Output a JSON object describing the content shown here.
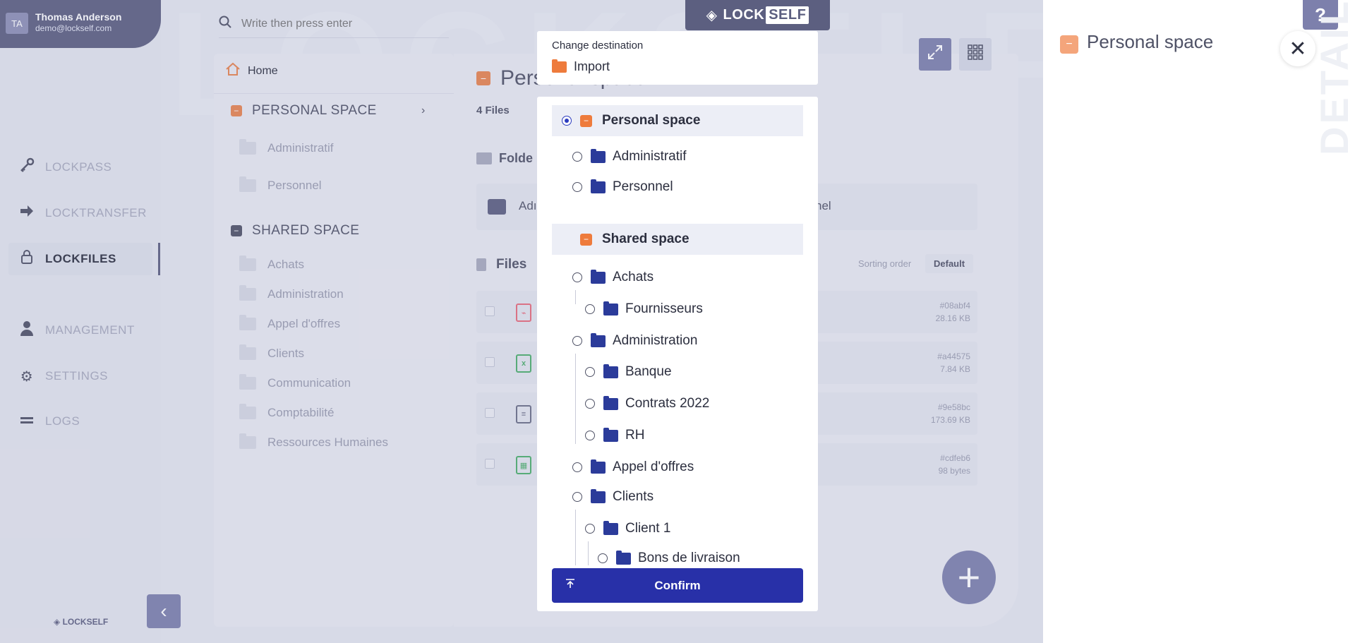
{
  "user": {
    "initials": "TA",
    "name": "Thomas Anderson",
    "email": "demo@lockself.com"
  },
  "nav": {
    "items": [
      {
        "label": "LOCKPASS",
        "icon": "key-icon"
      },
      {
        "label": "LOCKTRANSFER",
        "icon": "arrow-right-icon"
      },
      {
        "label": "LOCKFILES",
        "icon": "lock-icon",
        "active": true
      },
      {
        "label": "MANAGEMENT",
        "icon": "user-icon"
      },
      {
        "label": "SETTINGS",
        "icon": "gears-icon"
      },
      {
        "label": "LOGS",
        "icon": "list-icon"
      }
    ],
    "footer_logo": "LOCKSELF"
  },
  "search": {
    "placeholder": "Write then press enter"
  },
  "tree": {
    "home_label": "Home",
    "personal_section": "PERSONAL SPACE",
    "personal_folders": [
      "Administratif",
      "Personnel"
    ],
    "shared_section": "SHARED SPACE",
    "shared_folders": [
      "Achats",
      "Administration",
      "Appel d'offres",
      "Clients",
      "Communication",
      "Comptabilité",
      "Ressources Humaines"
    ]
  },
  "main": {
    "title": "Personal space",
    "file_count": "4 Files",
    "folders_label": "Folde",
    "folder_card_left": "Adı",
    "folder_card_right": "nel",
    "files_label": "Files",
    "sorting_label": "Sorting order",
    "sorting_value": "Default",
    "files": [
      {
        "type": "pdf",
        "hash": "#08abf4",
        "size": "28.16 KB"
      },
      {
        "type": "xls",
        "hash": "#a44575",
        "size": "7.84 KB"
      },
      {
        "type": "zip",
        "hash": "#9e58bc",
        "size": "173.69 KB"
      },
      {
        "type": "sheet",
        "hash": "#cdfeb6",
        "size": "98 bytes"
      }
    ]
  },
  "top_logo": {
    "lock": "LOCK",
    "self": "SELF"
  },
  "details": {
    "title": "Personal space",
    "vertical_text": "DETAILS"
  },
  "watermark": "LOCKSELF",
  "modal": {
    "dest_label": "Change destination",
    "dest_value": "Import",
    "tree": [
      {
        "label": "Personal space"
      },
      {
        "label": "Administratif"
      },
      {
        "label": "Personnel"
      },
      {
        "label": "Shared space"
      },
      {
        "label": "Achats"
      },
      {
        "label": "Fournisseurs"
      },
      {
        "label": "Administration"
      },
      {
        "label": "Banque"
      },
      {
        "label": "Contrats 2022"
      },
      {
        "label": "RH"
      },
      {
        "label": "Appel d'offres"
      },
      {
        "label": "Clients"
      },
      {
        "label": "Client 1"
      },
      {
        "label": "Bons de livraison"
      }
    ],
    "confirm_label": "Confirm"
  },
  "colors": {
    "accent": "#2830a8",
    "orange": "#ee7b3c",
    "folder_blue": "#2b3b9a",
    "nav_dark": "#5c5f80"
  }
}
